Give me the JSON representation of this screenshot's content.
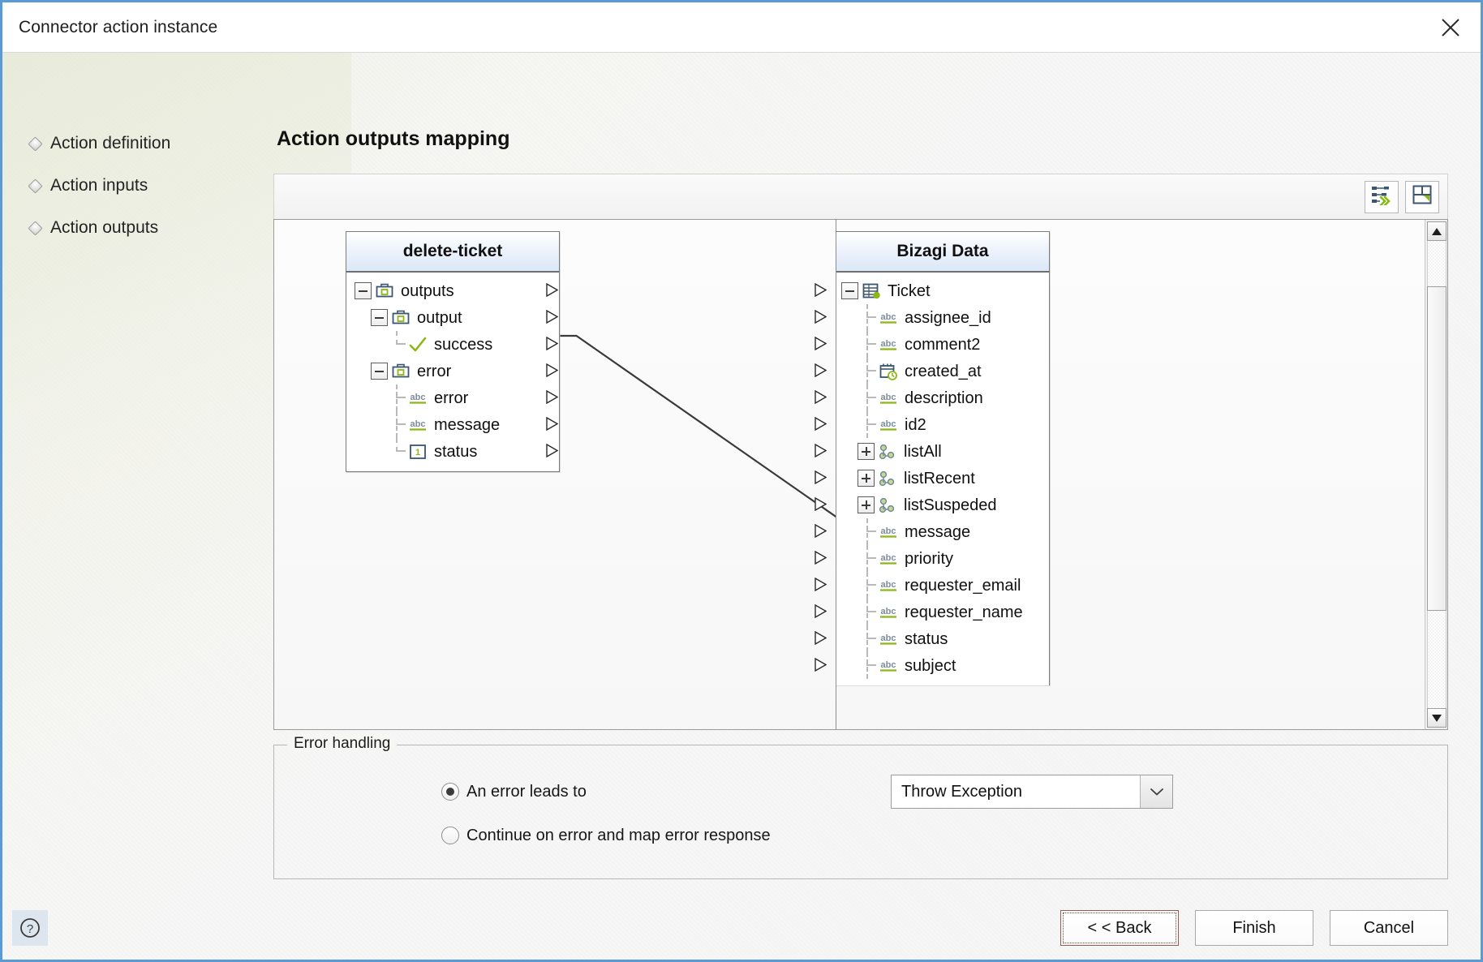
{
  "window": {
    "title": "Connector action instance",
    "close_icon": "close-icon"
  },
  "wizard_nav": {
    "items": [
      {
        "label": "Action definition"
      },
      {
        "label": "Action inputs"
      },
      {
        "label": "Action outputs"
      }
    ]
  },
  "page": {
    "title": "Action outputs mapping"
  },
  "toolbar": {
    "buttons": [
      {
        "name": "auto-map-button",
        "icon": "auto-map-icon",
        "tooltip": "Auto map"
      },
      {
        "name": "save-mapping-button",
        "icon": "save-mapping-icon",
        "tooltip": "Save mapping"
      }
    ]
  },
  "mapper": {
    "source_tree": {
      "title": "delete-ticket",
      "nodes": [
        {
          "label": "outputs",
          "depth": 0,
          "icon": "briefcase-icon",
          "toggle": "minus",
          "guide": "none",
          "port": true
        },
        {
          "label": "output",
          "depth": 1,
          "icon": "briefcase-icon",
          "toggle": "minus",
          "guide": "none",
          "port": true
        },
        {
          "label": "success",
          "depth": 2,
          "icon": "check-icon",
          "toggle": "none",
          "guide": "last",
          "port": true
        },
        {
          "label": "error",
          "depth": 1,
          "icon": "briefcase-icon",
          "toggle": "minus",
          "guide": "none",
          "port": true
        },
        {
          "label": "error",
          "depth": 2,
          "icon": "abc-icon",
          "toggle": "none",
          "guide": "tee",
          "port": true
        },
        {
          "label": "message",
          "depth": 2,
          "icon": "abc-icon",
          "toggle": "none",
          "guide": "tee",
          "port": true
        },
        {
          "label": "status",
          "depth": 2,
          "icon": "number-icon",
          "toggle": "none",
          "guide": "last",
          "port": true
        }
      ]
    },
    "target_tree": {
      "title": "Bizagi Data",
      "nodes": [
        {
          "label": "Ticket",
          "depth": 0,
          "icon": "entity-icon",
          "toggle": "minus",
          "guide": "none",
          "port": true
        },
        {
          "label": "assignee_id",
          "depth": 1,
          "icon": "abc-icon",
          "toggle": "none",
          "guide": "tee",
          "port": true
        },
        {
          "label": "comment2",
          "depth": 1,
          "icon": "abc-icon",
          "toggle": "none",
          "guide": "tee",
          "port": true
        },
        {
          "label": "created_at",
          "depth": 1,
          "icon": "datetime-icon",
          "toggle": "none",
          "guide": "tee",
          "port": true
        },
        {
          "label": "description",
          "depth": 1,
          "icon": "abc-icon",
          "toggle": "none",
          "guide": "tee",
          "port": true
        },
        {
          "label": "id2",
          "depth": 1,
          "icon": "abc-icon",
          "toggle": "none",
          "guide": "tee",
          "port": true
        },
        {
          "label": "listAll",
          "depth": 1,
          "icon": "collection-icon",
          "toggle": "plus",
          "guide": "vert",
          "port": true
        },
        {
          "label": "listRecent",
          "depth": 1,
          "icon": "collection-icon",
          "toggle": "plus",
          "guide": "vert",
          "port": true
        },
        {
          "label": "listSuspeded",
          "depth": 1,
          "icon": "collection-icon",
          "toggle": "plus",
          "guide": "vert",
          "port": true
        },
        {
          "label": "message",
          "depth": 1,
          "icon": "abc-icon",
          "toggle": "none",
          "guide": "tee",
          "port": true
        },
        {
          "label": "priority",
          "depth": 1,
          "icon": "abc-icon",
          "toggle": "none",
          "guide": "tee",
          "port": true
        },
        {
          "label": "requester_email",
          "depth": 1,
          "icon": "abc-icon",
          "toggle": "none",
          "guide": "tee",
          "port": true
        },
        {
          "label": "requester_name",
          "depth": 1,
          "icon": "abc-icon",
          "toggle": "none",
          "guide": "tee",
          "port": true
        },
        {
          "label": "status",
          "depth": 1,
          "icon": "abc-icon",
          "toggle": "none",
          "guide": "tee",
          "port": true
        },
        {
          "label": "subject",
          "depth": 1,
          "icon": "abc-icon",
          "toggle": "none",
          "guide": "tee",
          "port": true
        }
      ]
    },
    "links": [
      {
        "from": "success",
        "to": "message"
      }
    ],
    "scrollbar": {
      "up_icon": "triangle-up-icon",
      "down_icon": "triangle-down-icon"
    }
  },
  "error_handling": {
    "legend": "Error handling",
    "option_error_leads_to": "An error leads to",
    "option_continue": "Continue on error and map error response",
    "selected_option": "error_leads_to",
    "select_value": "Throw Exception",
    "select_arrow_icon": "chevron-down-icon"
  },
  "footer": {
    "help_icon": "help-icon",
    "back_label": "< < Back",
    "finish_label": "Finish",
    "cancel_label": "Cancel"
  },
  "colors": {
    "window_border": "#5b9bd5",
    "accent_green": "#8cb816",
    "icon_navy": "#3b566e",
    "link_line": "#3a3a3a"
  }
}
